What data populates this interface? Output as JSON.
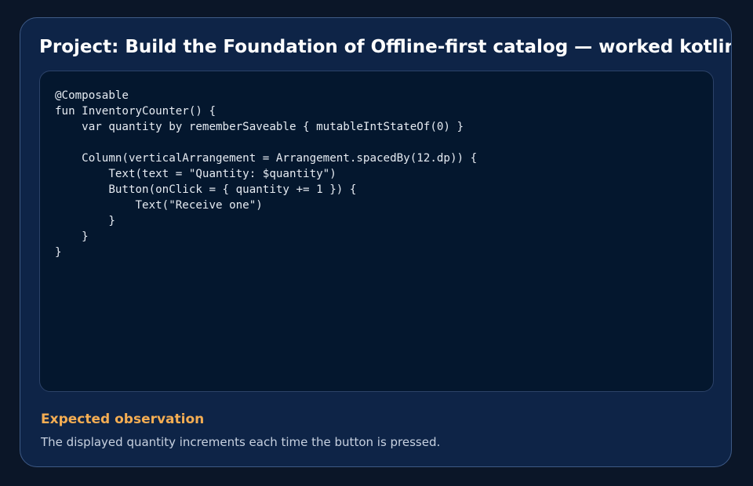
{
  "card": {
    "title": "Project: Build the Foundation of Offline-first catalog — worked kotlin example",
    "code": "@Composable\nfun InventoryCounter() {\n    var quantity by rememberSaveable { mutableIntStateOf(0) }\n\n    Column(verticalArrangement = Arrangement.spacedBy(12.dp)) {\n        Text(text = \"Quantity: $quantity\")\n        Button(onClick = { quantity += 1 }) {\n            Text(\"Receive one\")\n        }\n    }\n}",
    "observation": {
      "heading": "Expected observation",
      "text": "The displayed quantity increments each time the button is pressed."
    }
  },
  "colors": {
    "page_background": "#0b1628",
    "card_background": "#0e2447",
    "card_border": "#3e5a86",
    "code_background": "#04172e",
    "title_text": "#ffffff",
    "code_text": "#e6ebf2",
    "observation_heading": "#f4ad53",
    "observation_text": "#c7d1e0"
  }
}
